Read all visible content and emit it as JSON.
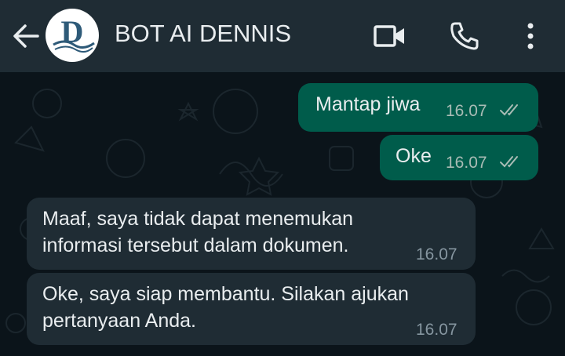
{
  "header": {
    "contact_name": "BOT AI DENNIS",
    "avatar_letter": "D",
    "icons": [
      "back-arrow-icon",
      "video-call-icon",
      "voice-call-icon",
      "more-options-icon"
    ]
  },
  "messages": [
    {
      "direction": "outgoing",
      "text": "Mantap jiwa",
      "time": "16.07",
      "status": "read"
    },
    {
      "direction": "outgoing",
      "text": "Oke",
      "time": "16.07",
      "status": "read"
    },
    {
      "direction": "incoming",
      "lines": [
        "Maaf, saya tidak dapat menemukan",
        "informasi tersebut dalam dokumen."
      ],
      "time": "16.07"
    },
    {
      "direction": "incoming",
      "lines": [
        "Oke, saya siap membantu. Silakan ajukan",
        "pertanyaan Anda."
      ],
      "time": "16.07"
    }
  ],
  "colors": {
    "header_bg": "#1f2c34",
    "chat_bg": "#0b141a",
    "outgoing_bubble": "#005c4b",
    "incoming_bubble": "#1f2c34",
    "text": "#e9edef"
  }
}
